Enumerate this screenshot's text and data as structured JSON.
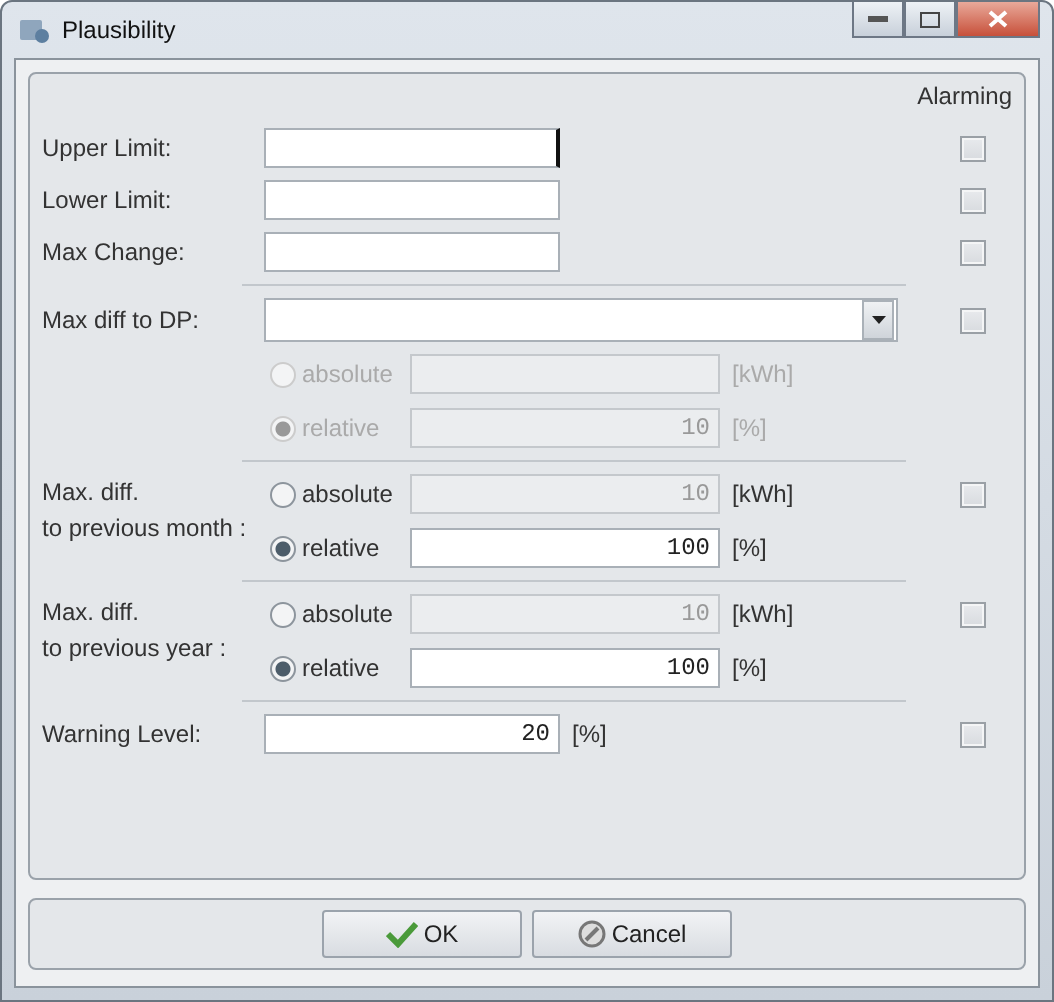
{
  "window": {
    "title": "Plausibility"
  },
  "alarming_header": "Alarming",
  "sections": [
    {
      "kind": "field",
      "label": "Upper Limit:",
      "focused": true,
      "alarming": false
    },
    {
      "kind": "field",
      "label": "Lower Limit:",
      "focused": false,
      "alarming": false
    },
    {
      "kind": "field",
      "label": "Max Change:",
      "focused": false,
      "alarming": false
    },
    {
      "kind": "select",
      "label": "Max diff to DP:",
      "alarming": false,
      "disabled": true,
      "options": [
        {
          "label": "absolute",
          "selected": false,
          "unit": "[kWh]"
        },
        {
          "label": "relative",
          "selected": true,
          "value": "10",
          "unit": "[%]"
        }
      ]
    },
    {
      "kind": "choice",
      "label": "Max. diff.\nto previous month :",
      "alarming": false,
      "options": [
        {
          "label": "absolute",
          "selected": false,
          "value": "10",
          "unit": "[kWh]"
        },
        {
          "label": "relative",
          "selected": true,
          "value": "100",
          "unit": "[%]"
        }
      ]
    },
    {
      "kind": "choice",
      "label": "Max. diff.\nto previous year :",
      "alarming": false,
      "options": [
        {
          "label": "absolute",
          "selected": false,
          "value": "10",
          "unit": "[kWh]"
        },
        {
          "label": "relative",
          "selected": true,
          "value": "100",
          "unit": "[%]"
        }
      ]
    },
    {
      "kind": "unitfield",
      "label": "Warning Level:",
      "value": "20",
      "unit": "[%]",
      "alarming": false
    }
  ],
  "buttons": [
    {
      "kind": "ok",
      "label": "OK"
    },
    {
      "kind": "cancel",
      "label": "Cancel"
    }
  ]
}
